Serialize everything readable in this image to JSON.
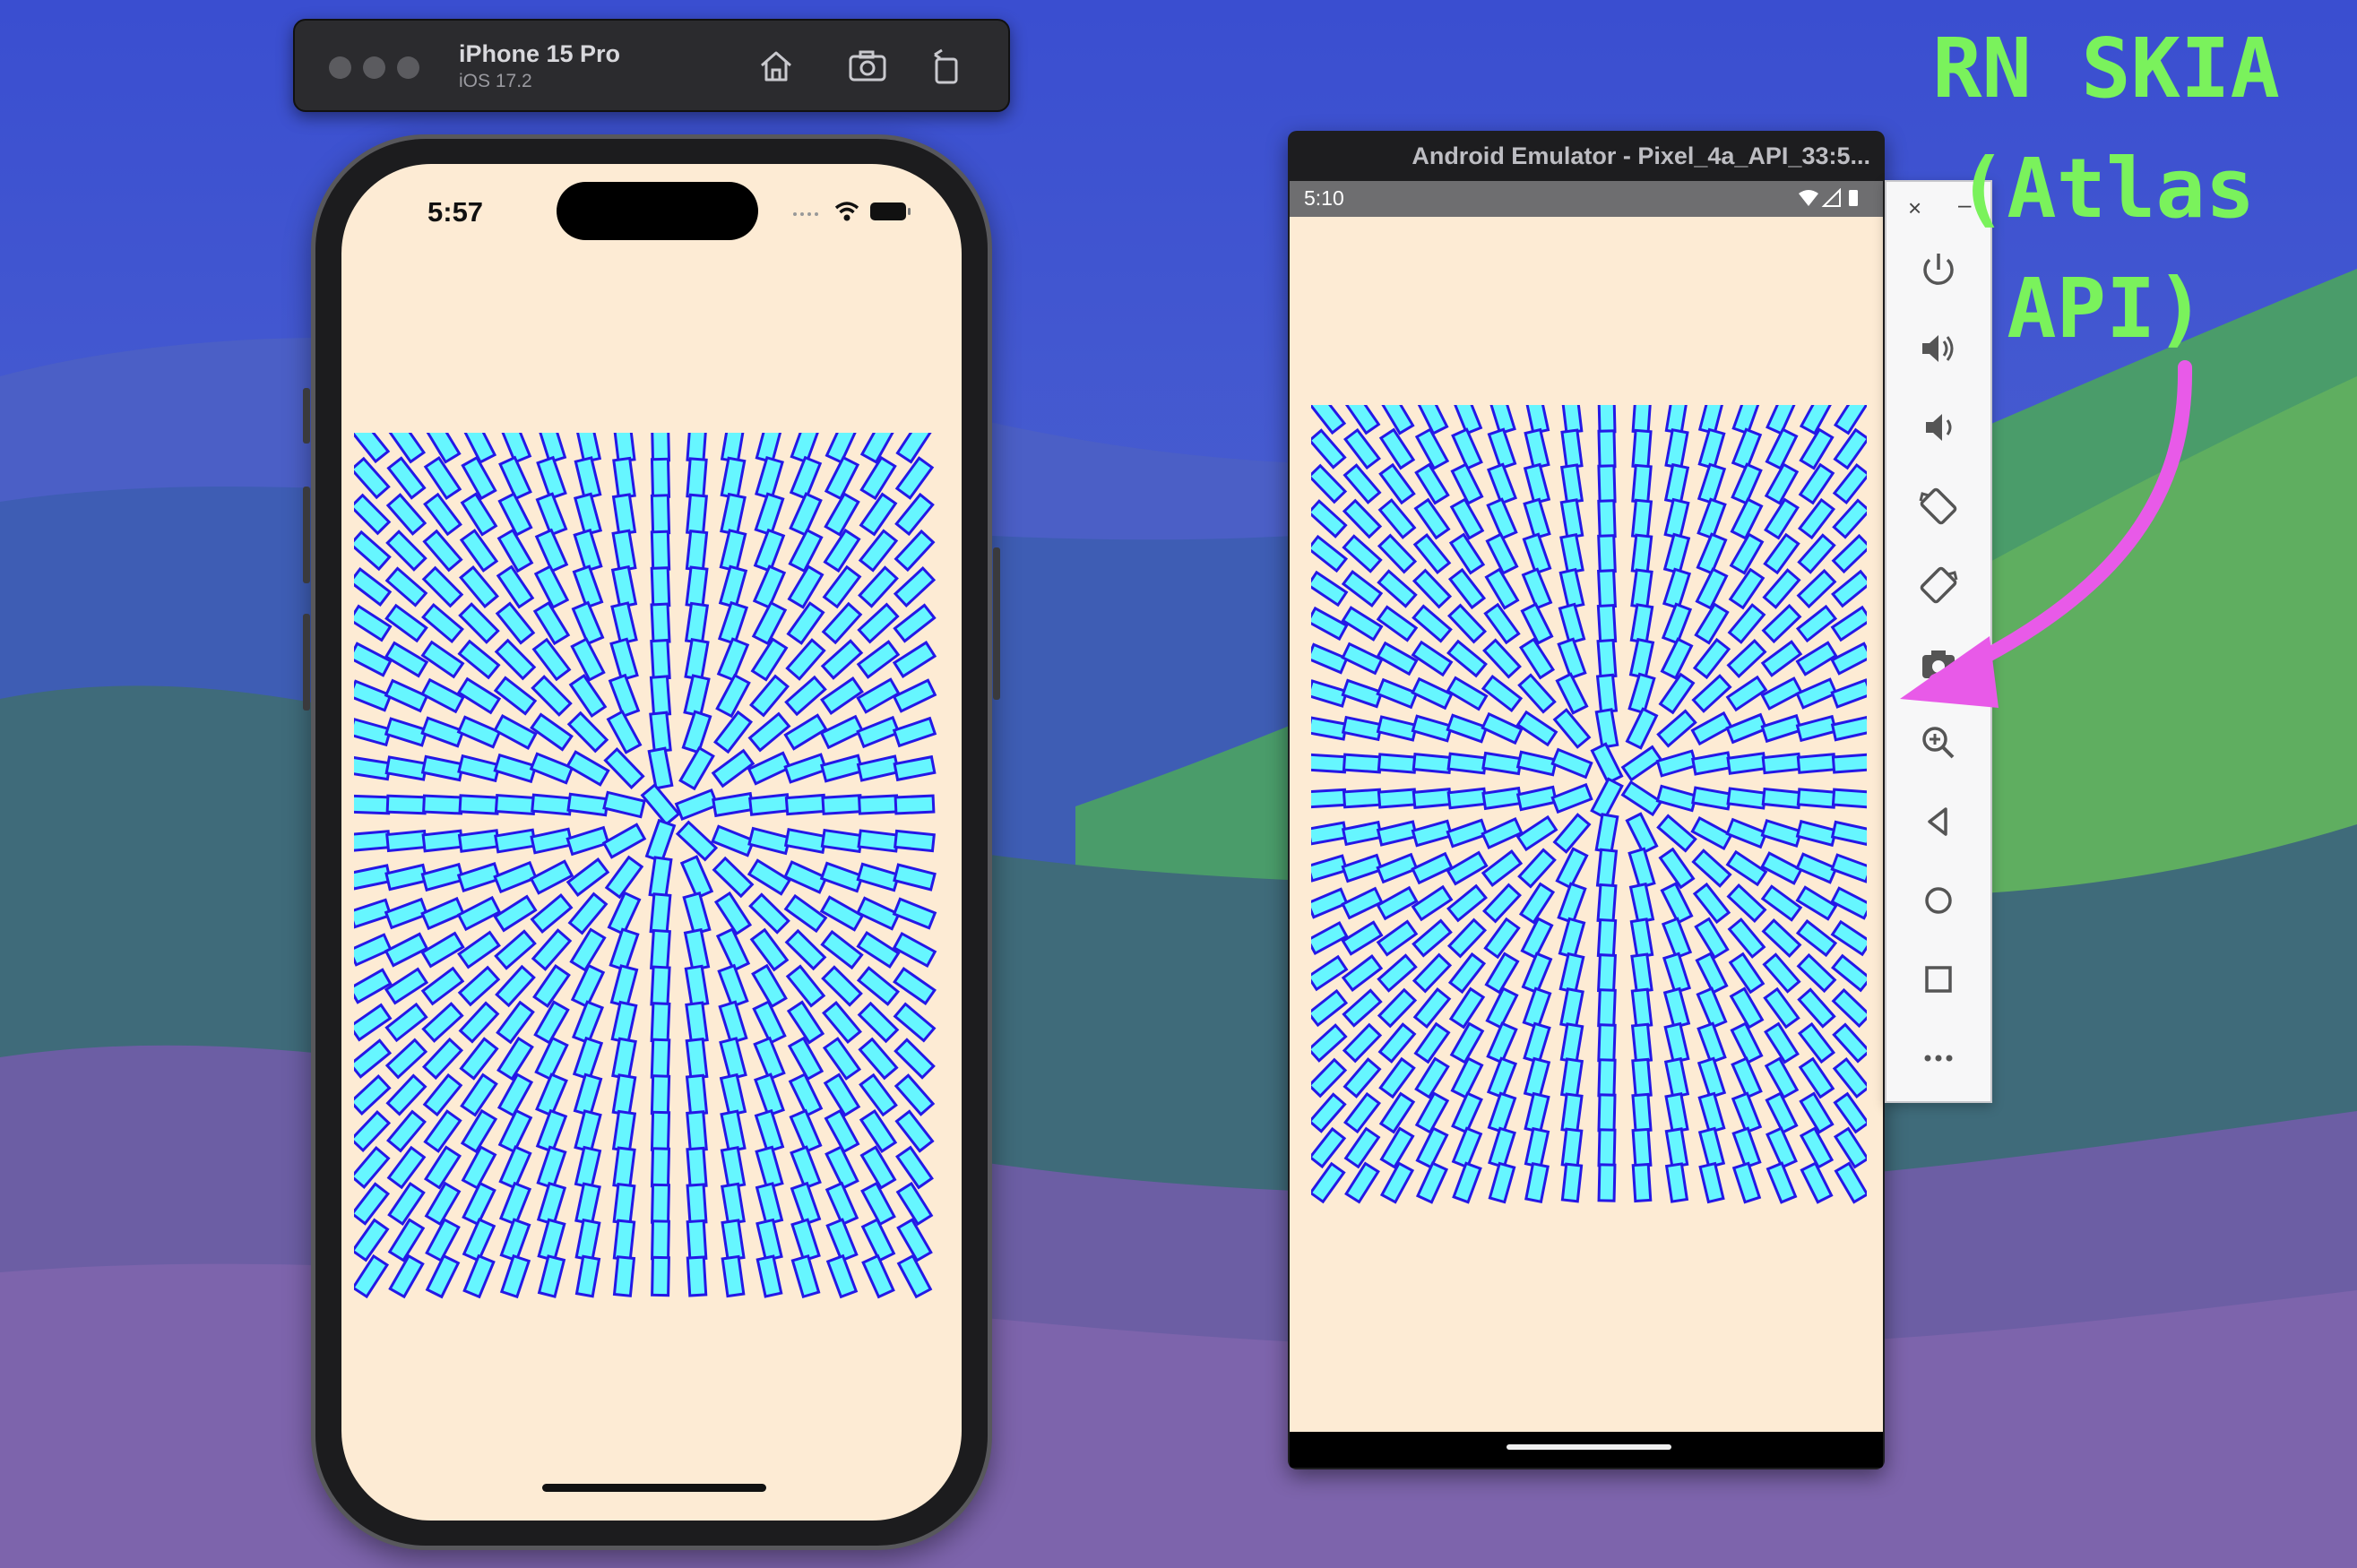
{
  "ios_simulator": {
    "toolbar": {
      "device_name": "iPhone 15 Pro",
      "os_version": "iOS 17.2",
      "icons": [
        "home-icon",
        "screenshot-icon",
        "rotate-icon"
      ]
    },
    "status_bar": {
      "time": "5:57",
      "icons": [
        "signal-dots-icon",
        "wifi-icon",
        "battery-icon"
      ]
    },
    "app_background": "#fdebd4"
  },
  "android_emulator": {
    "window_title": "Android Emulator - Pixel_4a_API_33:5...",
    "status_bar": {
      "time": "5:10",
      "icons": [
        "wifi-icon",
        "cellular-icon",
        "battery-icon"
      ]
    },
    "side_panel": {
      "window_controls": {
        "close": "×",
        "minimize": "–"
      },
      "buttons": [
        "power-icon",
        "volume-up-icon",
        "volume-down-icon",
        "rotate-left-icon",
        "rotate-right-icon",
        "camera-icon",
        "zoom-icon",
        "back-icon",
        "home-icon",
        "overview-icon",
        "more-icon"
      ]
    },
    "app_background": "#fdebd4"
  },
  "atlas_pattern": {
    "sprite_fill": "#66f6ff",
    "sprite_stroke": "#2418e6"
  },
  "annotation": {
    "lines": [
      "RN SKIA",
      "(Atlas",
      "API)"
    ],
    "text_color": "#7af25c",
    "arrow_color": "#e85ae8"
  }
}
